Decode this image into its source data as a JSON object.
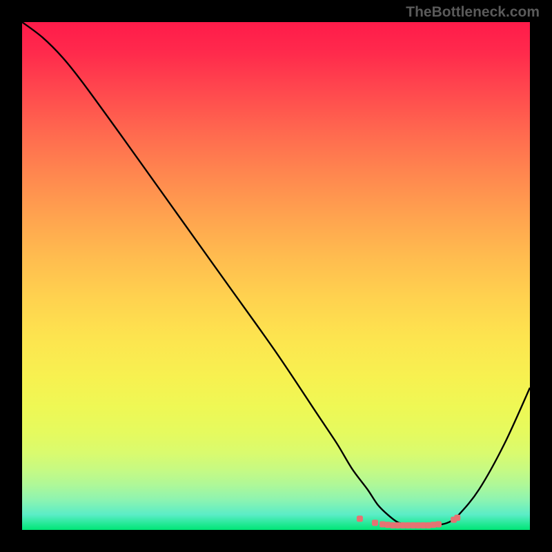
{
  "watermark": "TheBottleneck.com",
  "chart_data": {
    "type": "line",
    "title": "",
    "xlabel": "",
    "ylabel": "",
    "xlim": [
      0,
      100
    ],
    "ylim": [
      0,
      100
    ],
    "grid": false,
    "series": [
      {
        "name": "bottleneck-curve",
        "color": "#000000",
        "x": [
          0,
          4,
          8,
          12,
          20,
          30,
          40,
          50,
          58,
          62,
          65,
          68,
          70,
          72,
          74,
          76,
          78,
          80,
          82,
          84,
          86,
          90,
          95,
          100
        ],
        "y": [
          100,
          97,
          93,
          88,
          77,
          63,
          49,
          35,
          23,
          17,
          12,
          8,
          5,
          3,
          1.5,
          1,
          1,
          1,
          1,
          1.5,
          3,
          8,
          17,
          28
        ]
      },
      {
        "name": "highlight-dots",
        "color": "#e57373",
        "type": "scatter",
        "x": [
          66.5,
          69.5,
          71,
          72,
          73,
          74,
          75,
          76,
          77,
          78,
          79,
          80,
          81,
          82,
          85,
          85.7
        ],
        "y": [
          2.2,
          1.4,
          1.1,
          1.0,
          0.9,
          0.9,
          0.9,
          0.9,
          0.9,
          0.9,
          0.9,
          0.9,
          1.0,
          1.1,
          2.0,
          2.4
        ]
      }
    ],
    "background_gradient": {
      "top": "#ff1b4a",
      "mid_upper": "#ffa24f",
      "mid_lower": "#f7f150",
      "bottom": "#00e676"
    }
  }
}
